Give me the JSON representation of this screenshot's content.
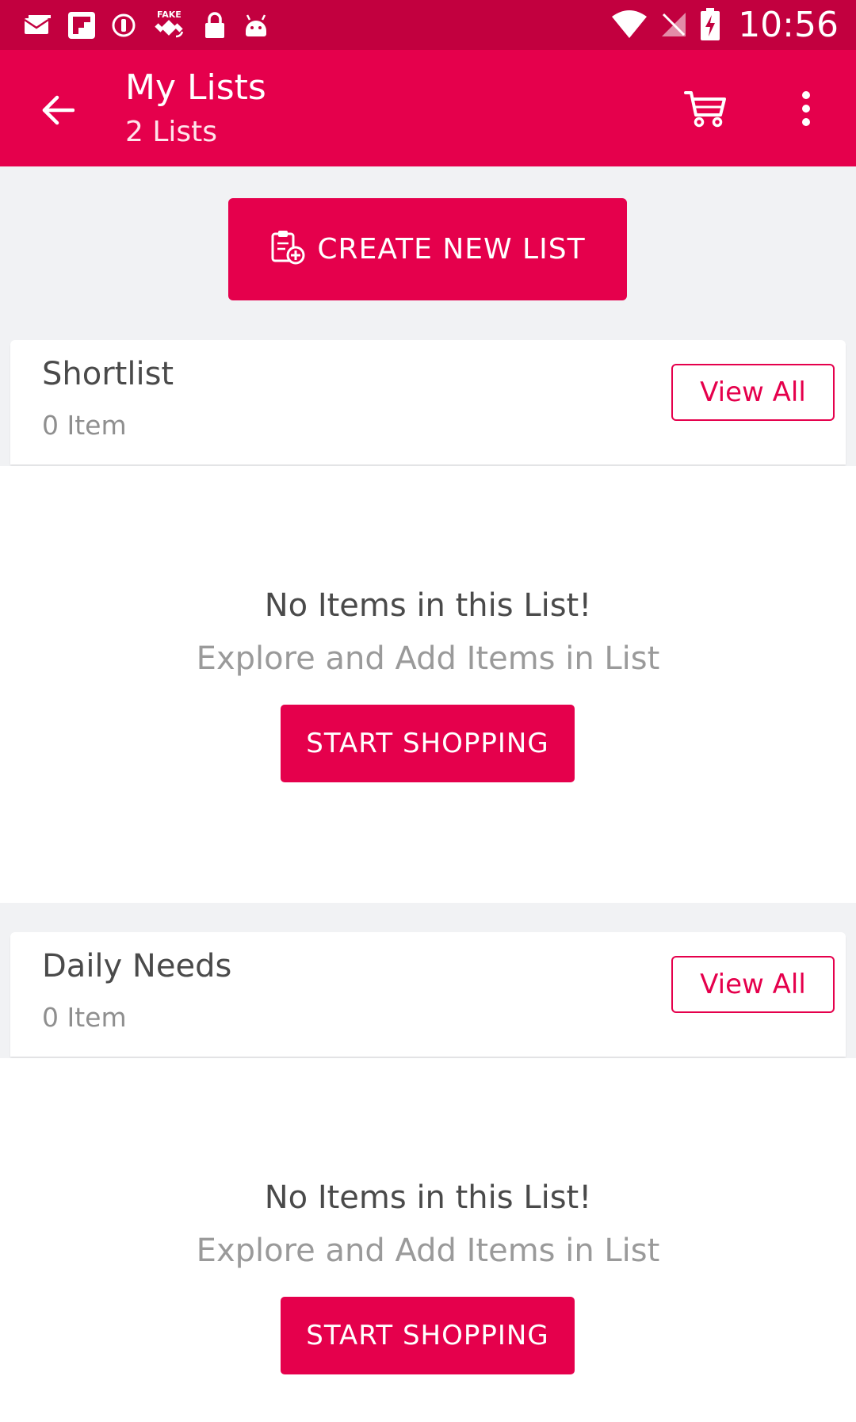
{
  "colors": {
    "status_bar": "#c2003f",
    "primary": "#e5004c",
    "background": "#f1f2f4",
    "card": "#ffffff",
    "text_dark": "#4a4a4a",
    "text_muted": "#9a9a9a"
  },
  "status_bar": {
    "left_icons": [
      "mail-icon",
      "flipboard-icon",
      "sync-icon",
      "fake-gps-icon",
      "lock-icon",
      "android-icon"
    ],
    "right_icons": [
      "wifi-icon",
      "no-signal-icon",
      "battery-charging-icon"
    ],
    "time": "10:56"
  },
  "app_bar": {
    "title": "My Lists",
    "subtitle": "2 Lists",
    "back_icon": "arrow-left-icon",
    "cart_icon": "cart-icon",
    "more_icon": "more-vert-icon"
  },
  "create_button": {
    "label": "CREATE NEW LIST",
    "icon": "clipboard-add-icon"
  },
  "lists": [
    {
      "name": "Shortlist",
      "count": "0 Item",
      "view_all": "View All",
      "empty_title": "No Items in this List!",
      "empty_subtitle": "Explore and Add Items in List",
      "cta": "START SHOPPING"
    },
    {
      "name": "Daily Needs",
      "count": "0 Item",
      "view_all": "View All",
      "empty_title": "No Items in this List!",
      "empty_subtitle": "Explore and Add Items in List",
      "cta": "START SHOPPING"
    }
  ]
}
